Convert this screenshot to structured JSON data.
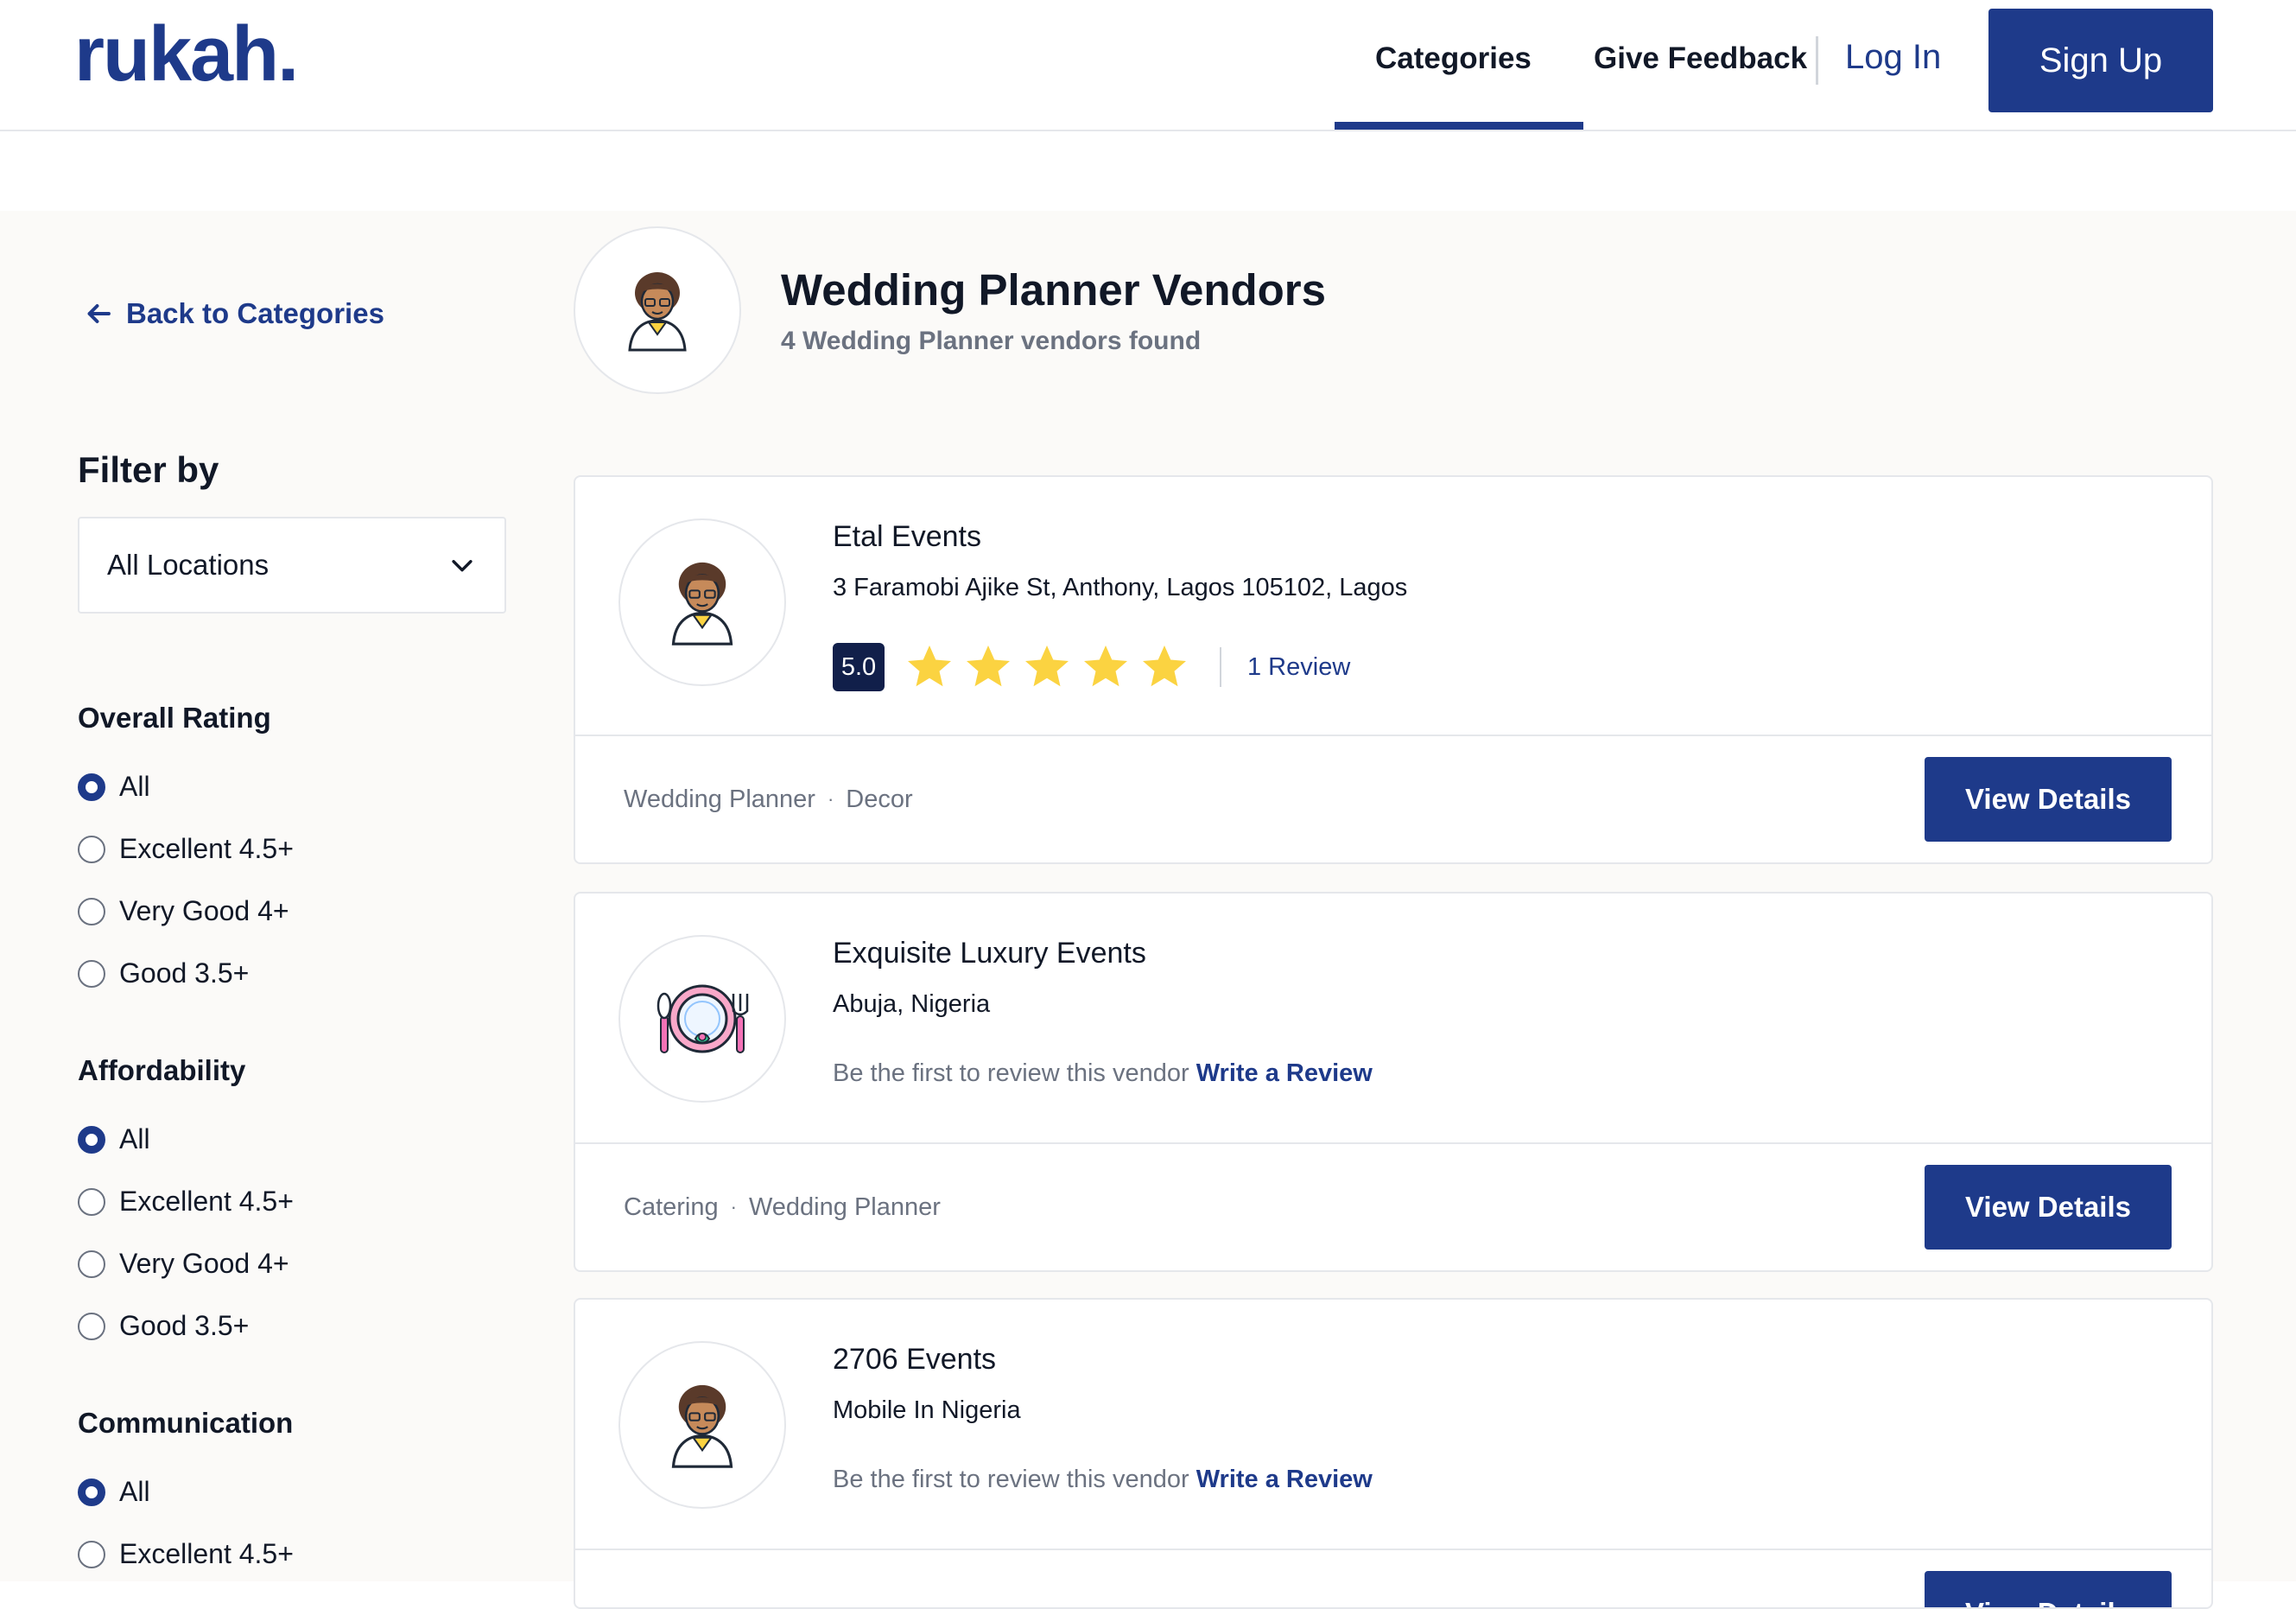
{
  "header": {
    "logo": "rukah.",
    "nav": {
      "categories": "Categories",
      "feedback": "Give Feedback",
      "login": "Log In",
      "signup": "Sign Up"
    }
  },
  "sidebar": {
    "back_label": "Back to Categories",
    "filter_title": "Filter by",
    "location_value": "All Locations",
    "groups": [
      {
        "title": "Overall Rating",
        "options": [
          "All",
          "Excellent 4.5+",
          "Very Good 4+",
          "Good 3.5+"
        ],
        "selected": "All"
      },
      {
        "title": "Affordability",
        "options": [
          "All",
          "Excellent 4.5+",
          "Very Good 4+",
          "Good 3.5+"
        ],
        "selected": "All"
      },
      {
        "title": "Communication",
        "options": [
          "All",
          "Excellent 4.5+"
        ],
        "selected": "All"
      }
    ]
  },
  "category": {
    "title": "Wedding Planner Vendors",
    "count_text": "4 Wedding Planner vendors found"
  },
  "vendors": [
    {
      "name": "Etal Events",
      "address": "3 Faramobi Ajike St, Anthony, Lagos 105102, Lagos",
      "rating": "5.0",
      "stars": 5,
      "reviews": "1 Review",
      "tags": [
        "Wedding Planner",
        "Decor"
      ],
      "button": "View Details",
      "avatar_icon": "planner-avatar-icon"
    },
    {
      "name": "Exquisite Luxury Events",
      "address": "Abuja, Nigeria",
      "no_review_text": "Be the first to review this vendor",
      "write_review": "Write a Review",
      "tags": [
        "Catering",
        "Wedding Planner"
      ],
      "button": "View Details",
      "avatar_icon": "plate-cutlery-icon"
    },
    {
      "name": "2706 Events",
      "address": "Mobile In Nigeria",
      "no_review_text": "Be the first to review this vendor",
      "write_review": "Write a Review",
      "tags": [],
      "button": "View Details",
      "avatar_icon": "planner-avatar-icon"
    }
  ],
  "colors": {
    "brand": "#1e3a8a",
    "star": "#fbd341",
    "badge": "#111f4a",
    "muted": "#6b7280",
    "page_bg": "#fbfaf8"
  }
}
